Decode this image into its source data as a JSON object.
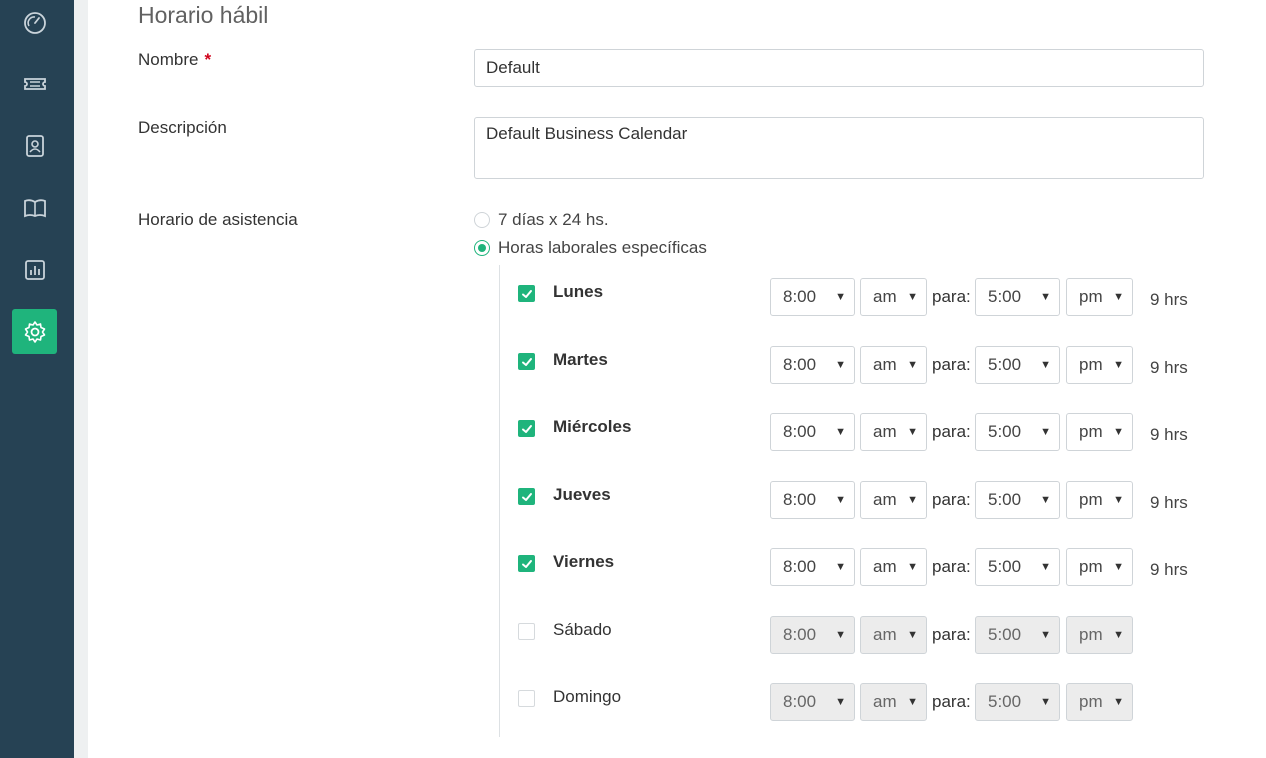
{
  "sidebar": {
    "items": [
      {
        "icon": "dashboard-icon"
      },
      {
        "icon": "ticket-icon"
      },
      {
        "icon": "contact-icon"
      },
      {
        "icon": "knowledge-base-icon"
      },
      {
        "icon": "reports-icon"
      },
      {
        "icon": "settings-icon",
        "active": true
      }
    ],
    "accent": "#1fb47c",
    "background": "#264254"
  },
  "page": {
    "title": "Horario hábil",
    "name_label": "Nombre",
    "required_mark": "*",
    "name_value": "Default",
    "description_label": "Descripción",
    "description_value": "Default Business Calendar",
    "schedule_label": "Horario de asistencia",
    "option_24x7": "7 días x 24 hs.",
    "option_specific": "Horas laborales específicas",
    "selected_option": "specific",
    "to_label": "para:"
  },
  "days": [
    {
      "name": "Lunes",
      "enabled": true,
      "from": "8:00",
      "from_ampm": "am",
      "to": "5:00",
      "to_ampm": "pm",
      "hours": "9 hrs"
    },
    {
      "name": "Martes",
      "enabled": true,
      "from": "8:00",
      "from_ampm": "am",
      "to": "5:00",
      "to_ampm": "pm",
      "hours": "9 hrs"
    },
    {
      "name": "Miércoles",
      "enabled": true,
      "from": "8:00",
      "from_ampm": "am",
      "to": "5:00",
      "to_ampm": "pm",
      "hours": "9 hrs"
    },
    {
      "name": "Jueves",
      "enabled": true,
      "from": "8:00",
      "from_ampm": "am",
      "to": "5:00",
      "to_ampm": "pm",
      "hours": "9 hrs"
    },
    {
      "name": "Viernes",
      "enabled": true,
      "from": "8:00",
      "from_ampm": "am",
      "to": "5:00",
      "to_ampm": "pm",
      "hours": "9 hrs"
    },
    {
      "name": "Sábado",
      "enabled": false,
      "from": "8:00",
      "from_ampm": "am",
      "to": "5:00",
      "to_ampm": "pm",
      "hours": ""
    },
    {
      "name": "Domingo",
      "enabled": false,
      "from": "8:00",
      "from_ampm": "am",
      "to": "5:00",
      "to_ampm": "pm",
      "hours": ""
    }
  ]
}
